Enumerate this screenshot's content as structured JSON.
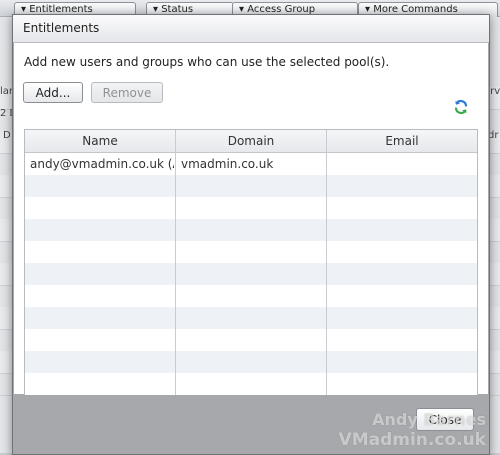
{
  "background": {
    "toolbar_buttons": [
      "▾ Entitlements",
      "▾ Status",
      "▾ Access Group",
      "▾ More Commands"
    ],
    "left_fragments": [
      "lar",
      "2 D",
      "D"
    ],
    "right_fragments": [
      "erve",
      "dr"
    ]
  },
  "dialog": {
    "title": "Entitlements",
    "instruction": "Add new users and groups who can use the selected pool(s).",
    "add_label": "Add...",
    "remove_label": "Remove",
    "refresh_icon": "refresh-icon",
    "columns": [
      "Name",
      "Domain",
      "Email"
    ],
    "rows": [
      {
        "name": "andy@vmadmin.co.uk (A",
        "domain": "vmadmin.co.uk",
        "email": ""
      }
    ],
    "close_label": "Close"
  },
  "watermark": {
    "line1": "Andy Barnes",
    "line2": "VMadmin.co.uk"
  },
  "colors": {
    "row_alt": "#eef1f5",
    "refresh_blue": "#2b7bd3",
    "refresh_green": "#3aa84a"
  }
}
